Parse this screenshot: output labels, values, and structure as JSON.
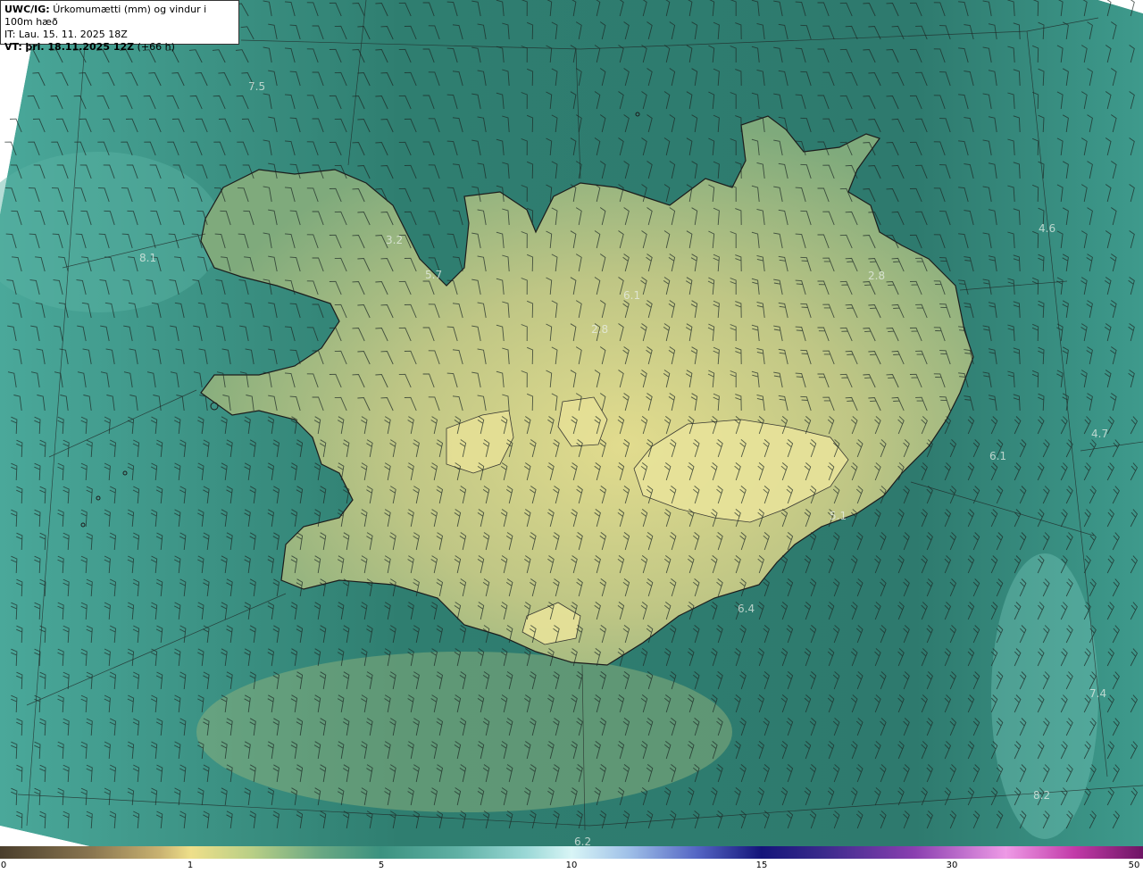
{
  "header": {
    "product": "UWC/IG:",
    "description": "Úrkomumætti (mm) og vindur i 100m hæð",
    "initial_time": "IT: Lau. 15. 11. 2025 18Z",
    "valid_time_label": "VT:",
    "valid_time": "þri. 18.11.2025 12Z",
    "lead_time": "(+66 h)"
  },
  "colorbar": {
    "ticks": [
      "0",
      "1",
      "5",
      "10",
      "15",
      "30",
      "50"
    ],
    "unit": "mm"
  },
  "map_labels": [
    {
      "text": "7.5"
    },
    {
      "text": "8.1"
    },
    {
      "text": "3.2"
    },
    {
      "text": "5.7"
    },
    {
      "text": "6.1"
    },
    {
      "text": "2.8"
    },
    {
      "text": "2.8"
    },
    {
      "text": "4.6"
    },
    {
      "text": "4.7"
    },
    {
      "text": "6.1"
    },
    {
      "text": "5.1"
    },
    {
      "text": "6.4"
    },
    {
      "text": "7.4"
    },
    {
      "text": "8.2"
    },
    {
      "text": "6.2"
    }
  ],
  "colors": {
    "ocean": "#2f7e70",
    "land_low": "#7aa57a",
    "land_high": "#e0dc8c",
    "coastline": "#1c1c1c",
    "barb": "#1e2a26"
  }
}
